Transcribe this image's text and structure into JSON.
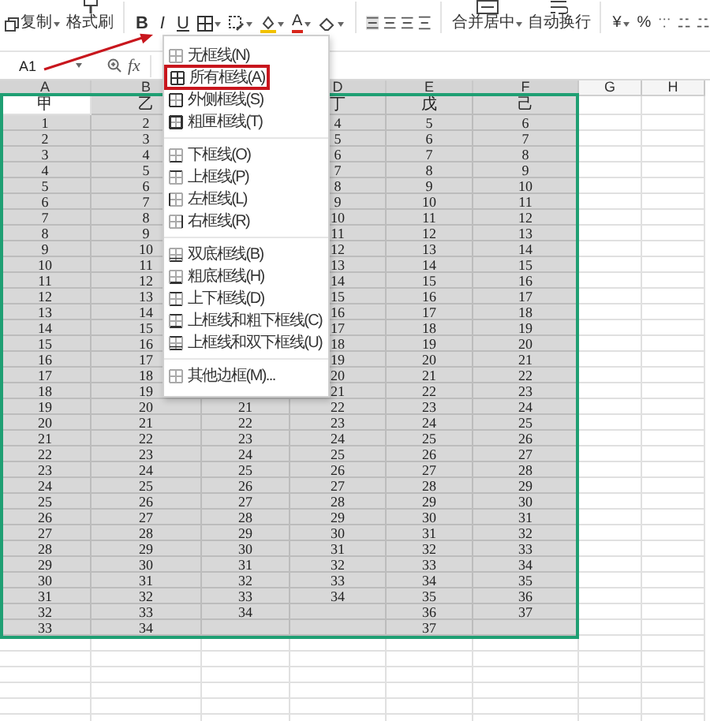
{
  "toolbar": {
    "copy": {
      "label": "复制"
    },
    "format_painter": {
      "label": "格式刷"
    },
    "style_buttons": [
      "B",
      "I",
      "U"
    ],
    "font_color": "A",
    "merge": {
      "label": "合并居中"
    },
    "wrap": {
      "label": "自动换行"
    },
    "currency": "¥",
    "percent": "%"
  },
  "formula_bar": {
    "cell_ref": "A1",
    "fx": "fx"
  },
  "sheet": {
    "columns": [
      {
        "label": "A",
        "selected": true
      },
      {
        "label": "B",
        "selected": true
      },
      {
        "selected": true
      },
      {
        "label": "D",
        "selected": true
      },
      {
        "label": "E",
        "selected": true
      },
      {
        "label": "F",
        "selected": true
      },
      {
        "label": "G",
        "selected": false
      },
      {
        "label": "H",
        "selected": false
      }
    ],
    "rows": [
      [
        {
          "text": "甲",
          "active": true
        },
        "乙",
        null,
        "丁",
        "戊",
        "己"
      ],
      [
        "1",
        "2",
        null,
        "4",
        "5",
        "6"
      ],
      [
        "2",
        "3",
        null,
        "5",
        "6",
        "7"
      ],
      [
        "3",
        "4",
        null,
        "6",
        "7",
        "8"
      ],
      [
        "4",
        "5",
        null,
        "7",
        "8",
        "9"
      ],
      [
        "5",
        "6",
        null,
        "8",
        "9",
        "10"
      ],
      [
        "6",
        "7",
        null,
        "9",
        "10",
        "11"
      ],
      [
        "7",
        "8",
        null,
        "10",
        "11",
        "12"
      ],
      [
        "8",
        "9",
        null,
        "11",
        "12",
        "13"
      ],
      [
        "9",
        "10",
        null,
        "12",
        "13",
        "14"
      ],
      [
        "10",
        "11",
        null,
        "13",
        "14",
        "15"
      ],
      [
        "11",
        "12",
        null,
        "14",
        "15",
        "16"
      ],
      [
        "12",
        "13",
        null,
        "15",
        "16",
        "17"
      ],
      [
        "13",
        "14",
        null,
        "16",
        "17",
        "18"
      ],
      [
        "14",
        "15",
        null,
        "17",
        "18",
        "19"
      ],
      [
        "15",
        "16",
        null,
        "18",
        "19",
        "20"
      ],
      [
        "16",
        "17",
        null,
        "19",
        "20",
        "21"
      ],
      [
        "17",
        "18",
        null,
        "20",
        "21",
        "22"
      ],
      [
        "18",
        "19",
        null,
        "21",
        "22",
        "23"
      ],
      [
        "19",
        "20",
        "21",
        "22",
        "23",
        "24"
      ],
      [
        "20",
        "21",
        "22",
        "23",
        "24",
        "25"
      ],
      [
        "21",
        "22",
        "23",
        "24",
        "25",
        "26"
      ],
      [
        "22",
        "23",
        "24",
        "25",
        "26",
        "27"
      ],
      [
        "23",
        "24",
        "25",
        "26",
        "27",
        "28"
      ],
      [
        "24",
        "25",
        "26",
        "27",
        "28",
        "29"
      ],
      [
        "25",
        "26",
        "27",
        "28",
        "29",
        "30"
      ],
      [
        "26",
        "27",
        "28",
        "29",
        "30",
        "31"
      ],
      [
        "27",
        "28",
        "29",
        "30",
        "31",
        "32"
      ],
      [
        "28",
        "29",
        "30",
        "31",
        "32",
        "33"
      ],
      [
        "29",
        "30",
        "31",
        "32",
        "33",
        "34"
      ],
      [
        "30",
        "31",
        "32",
        "33",
        "34",
        "35"
      ],
      [
        "31",
        "32",
        "33",
        "34",
        "35",
        "36"
      ],
      [
        "32",
        "33",
        "34",
        null,
        "36",
        "37"
      ],
      [
        "33",
        "34",
        null,
        null,
        "37",
        null
      ]
    ]
  },
  "border_menu": {
    "groups": [
      [
        {
          "label": "无框线(N)",
          "selected": false
        },
        {
          "label": "所有框线(A)",
          "selected": true
        },
        {
          "label": "外侧框线(S)",
          "selected": false
        },
        {
          "label": "粗匣框线(T)",
          "selected": false
        }
      ],
      [
        {
          "label": "下框线(O)",
          "selected": false
        },
        {
          "label": "上框线(P)",
          "selected": false
        },
        {
          "label": "左框线(L)",
          "selected": false
        },
        {
          "label": "右框线(R)",
          "selected": false
        }
      ],
      [
        {
          "label": "双底框线(B)",
          "selected": false
        },
        {
          "label": "粗底框线(H)",
          "selected": false
        },
        {
          "label": "上下框线(D)",
          "selected": false
        },
        {
          "label": "上框线和粗下框线(C)",
          "selected": false
        },
        {
          "label": "上框线和双下框线(U)",
          "selected": false
        }
      ],
      [
        {
          "label": "其他边框(M)...",
          "selected": false
        }
      ]
    ]
  }
}
